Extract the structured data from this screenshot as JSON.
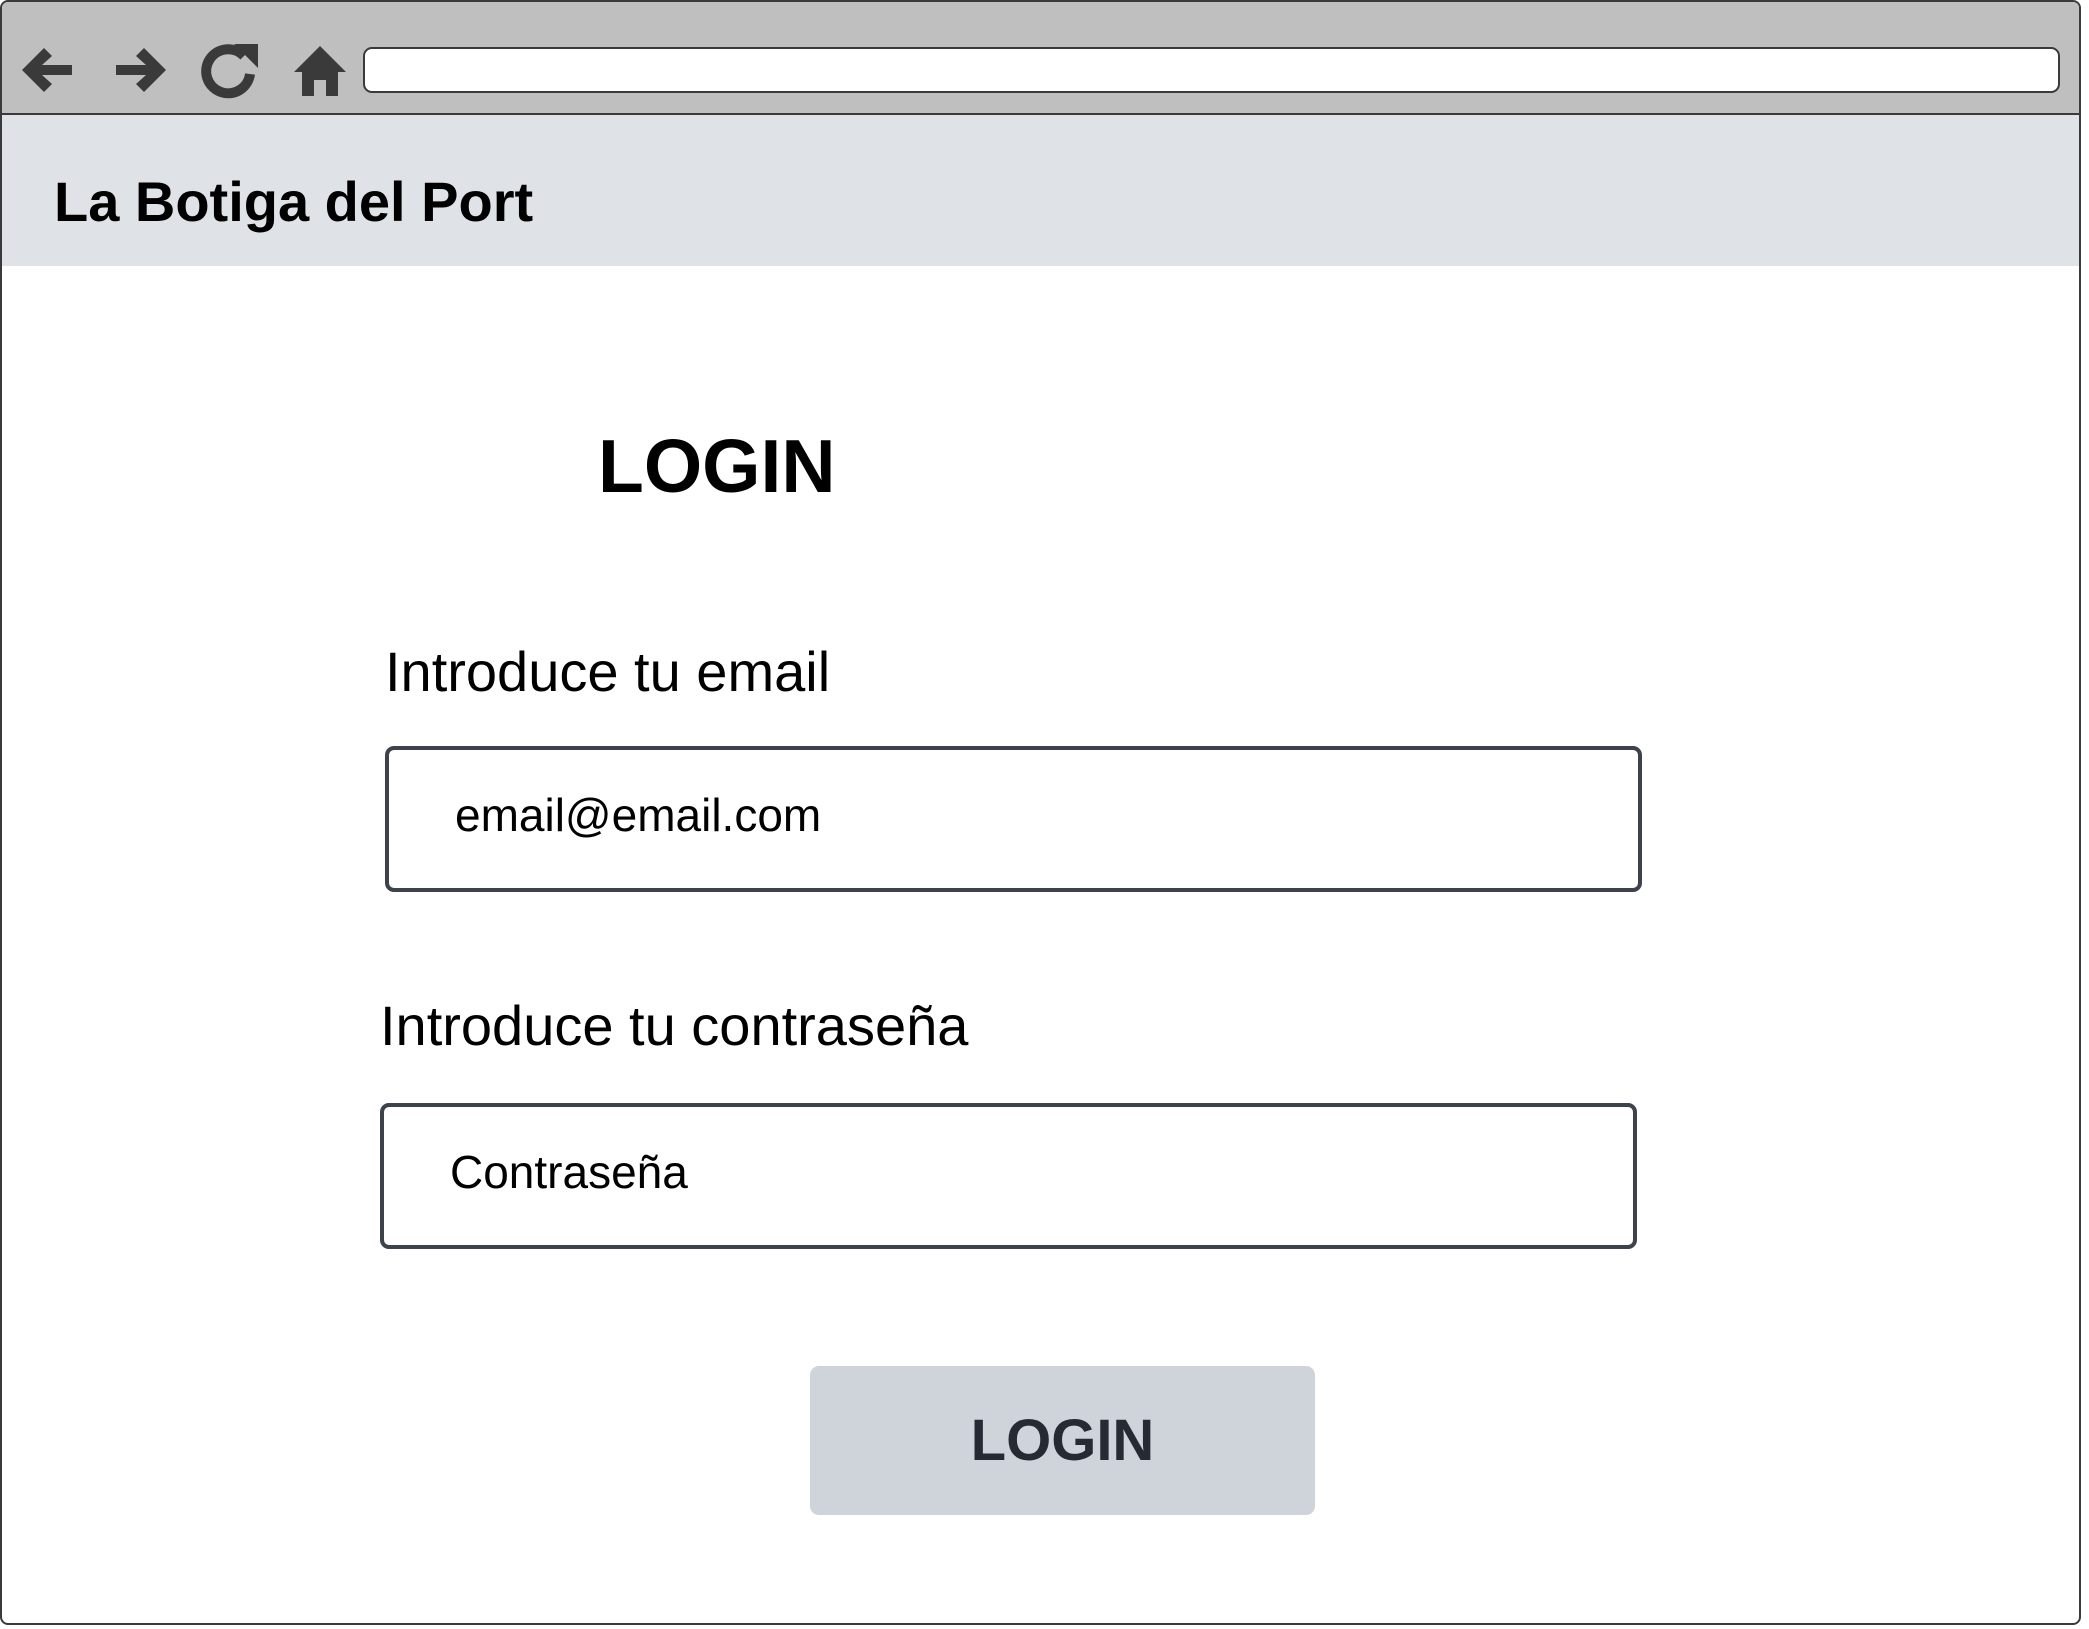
{
  "browser": {
    "address": ""
  },
  "header": {
    "site_title": "La Botiga del Port"
  },
  "login": {
    "title": "LOGIN",
    "email_label": "Introduce tu email",
    "email_value": "email@email.com",
    "password_label": "Introduce tu contraseña",
    "password_value": "Contraseña",
    "submit_label": "LOGIN"
  },
  "colors": {
    "toolbar": "#bfbfbf",
    "header": "#dfe2e6",
    "button": "#cfd4db",
    "field_border": "#3d424c"
  },
  "icons": [
    "back-arrow-icon",
    "forward-arrow-icon",
    "reload-icon",
    "home-icon"
  ]
}
